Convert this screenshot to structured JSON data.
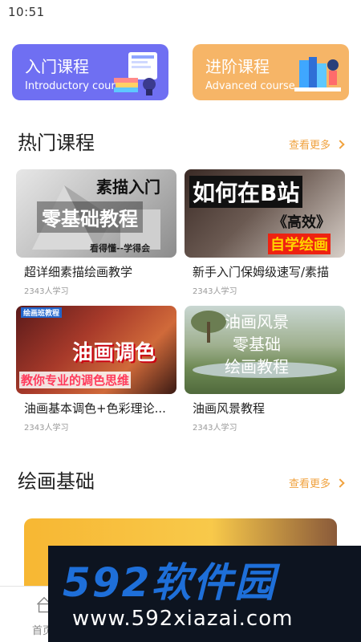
{
  "status_bar": {
    "time": "10:51"
  },
  "course_cards": [
    {
      "title": "入门课程",
      "subtitle": "Introductory course"
    },
    {
      "title": "进阶课程",
      "subtitle": "Advanced course"
    }
  ],
  "hot_section": {
    "title": "热门课程",
    "more": "查看更多"
  },
  "hot_courses": [
    {
      "title": "超详细素描绘画教学",
      "count": "2343人学习",
      "thumb_lines": [
        "素描入门",
        "零基础教程",
        "看得懂--学得会"
      ]
    },
    {
      "title": "新手入门保姆级速写/素描",
      "count": "2343人学习",
      "thumb_lines": [
        "如何在B站",
        "《高效》",
        "自学绘画"
      ]
    },
    {
      "title": "油画基本调色+色彩理论...",
      "count": "2343人学习",
      "thumb_lines": [
        "绘画班教程",
        "油画调色",
        "教你专业的调色思维"
      ]
    },
    {
      "title": "油画风景教程",
      "count": "2343人学习",
      "thumb_lines": [
        "油画风景",
        "零基础",
        "绘画教程"
      ]
    }
  ],
  "basic_section": {
    "title": "绘画基础",
    "more": "查看更多"
  },
  "tab_bar": {
    "home_label": "首页"
  },
  "watermark": {
    "logo": "592软件园",
    "url": "www.592xiazai.com"
  },
  "colors": {
    "intro_card": "#6f6ff2",
    "advanced_card": "#f6b567",
    "more_link": "#f0a23e"
  }
}
